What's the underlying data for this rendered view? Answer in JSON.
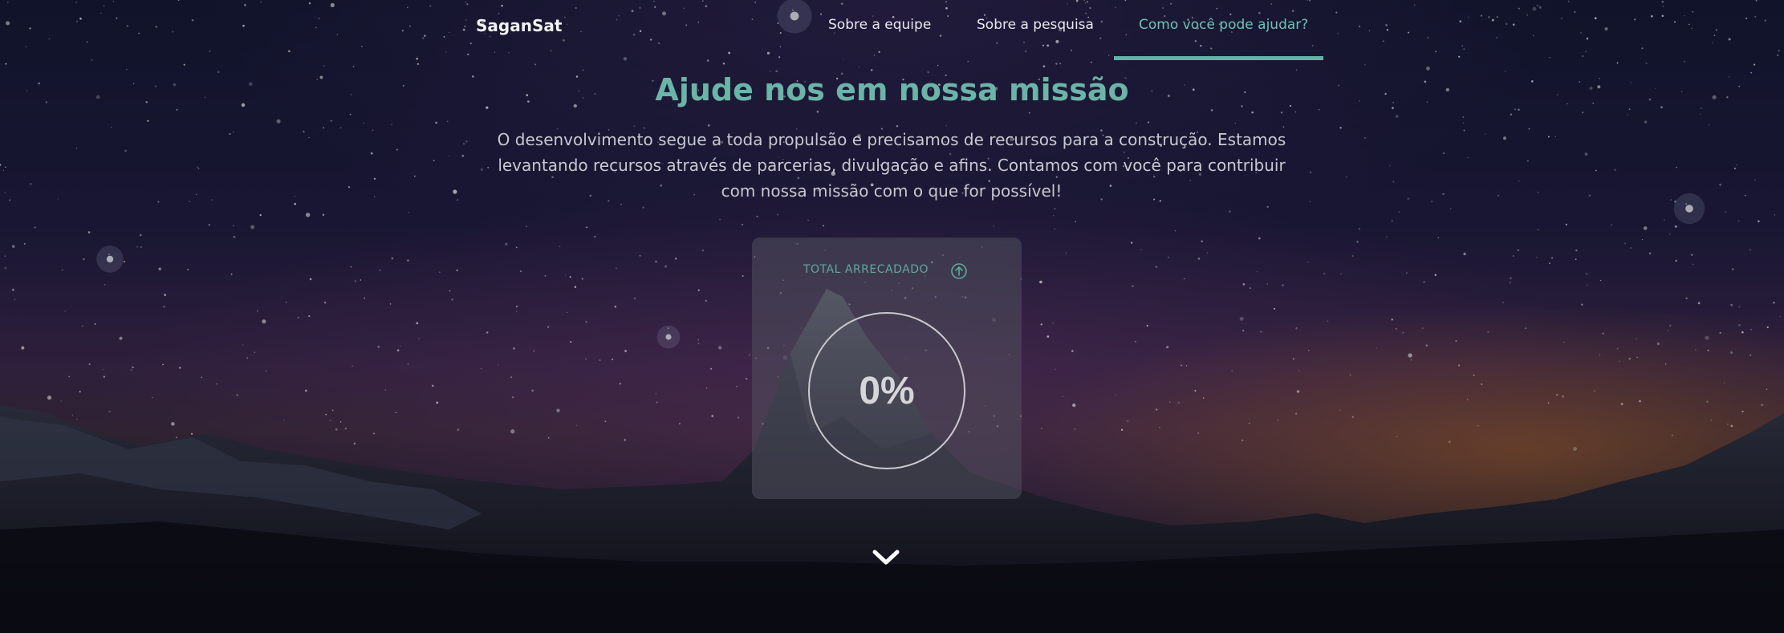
{
  "nav": {
    "brand": "SaganSat",
    "links": [
      {
        "label": "Sobre a equipe"
      },
      {
        "label": "Sobre a pesquisa"
      },
      {
        "label": "Como você pode ajudar?"
      }
    ]
  },
  "hero": {
    "title": "Ajude nos em nossa missão",
    "description": "O desenvolvimento segue a toda propulsão e precisamos de recursos para a construção. Estamos levantando recursos através de parcerias, divulgação e afins. Contamos com você para contribuir com nossa missão com o que for possível!"
  },
  "fundraising": {
    "label": "TOTAL ARRECADADO",
    "icon": "arrow-up-circle-icon",
    "progress_text": "0%",
    "progress_fraction": 0
  },
  "scroll": {
    "icon": "chevron-down-icon"
  },
  "colors": {
    "accent": "#6bb4a8",
    "active_underline": "#5fb5a9",
    "text": "#c9c7cf"
  }
}
